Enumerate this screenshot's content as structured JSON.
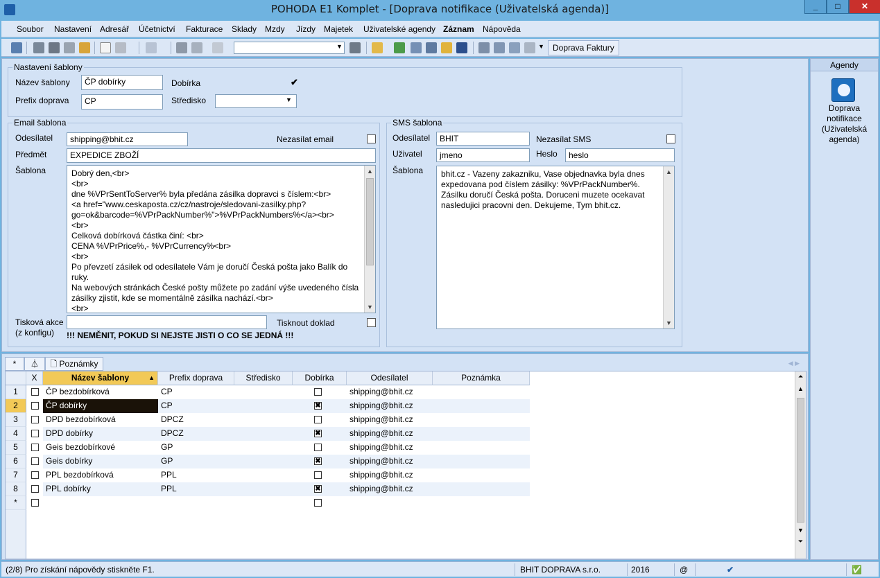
{
  "window": {
    "title": "POHODA E1 Komplet - [Doprava notifikace (Uživatelská agenda)]"
  },
  "menu": [
    "Soubor",
    "Nastavení",
    "Adresář",
    "Účetnictví",
    "Fakturace",
    "Sklady",
    "Mzdy",
    "Jízdy",
    "Majetek",
    "Uživatelské agendy",
    "Záznam",
    "Nápověda"
  ],
  "toolbar": {
    "button_label": "Doprava Faktury",
    "search_value": ""
  },
  "template_settings": {
    "group_label": "Nastavení šablony",
    "name_label": "Název šablony",
    "name_value": "ČP dobírky",
    "cod_label": "Dobírka",
    "cod_checked": "✔",
    "prefix_label": "Prefix doprava",
    "prefix_value": "CP",
    "center_label": "Středisko",
    "center_value": ""
  },
  "email": {
    "group_label": "Email šablona",
    "sender_label": "Odesílatel",
    "sender_value": "shipping@bhit.cz",
    "nosend_label": "Nezasílat email",
    "subject_label": "Předmět",
    "subject_value": "EXPEDICE ZBOŽÍ",
    "template_label": "Šablona",
    "template_lines": [
      "Dobrý den,<br>",
      "<br>",
      "dne %VPrSentToServer% byla předána zásilka dopravci s číslem:<br>",
      "<a href=\"www.ceskaposta.cz/cz/nastroje/sledovani-zasilky.php?",
      "go=ok&barcode=%VPrPackNumber%\">%VPrPackNumbers%</a><br>",
      "<br>",
      "Celková dobírková částka činí: <br>",
      "CENA %VPrPrice%,- %VPrCurrency%<br>",
      "<br>",
      "Po převzetí zásilek od odesílatele Vám je doručí Česká pošta jako Balík do ruky.",
      "Na webových stránkách České pošty můžete po zadání výše uvedeného čísla",
      "zásilky zjistit, kde se momentálně zásilka nachází.<br>",
      "<br>"
    ],
    "print_action_label_1": "Tisková akce",
    "print_action_label_2": "(z konfigu)",
    "print_action_value": "",
    "print_doc_label": "Tisknout doklad",
    "warning": "!!! NEMĚNIT, POKUD SI NEJSTE JISTI O CO SE JEDNÁ !!!"
  },
  "sms": {
    "group_label": "SMS šablona",
    "sender_label": "Odesílatel",
    "sender_value": "BHIT",
    "nosend_label": "Nezasílat SMS",
    "user_label": "Uživatel",
    "user_value": "jmeno",
    "pass_label": "Heslo",
    "pass_value": "heslo",
    "template_label": "Šablona",
    "template_lines": [
      "bhit.cz - Vazeny zakazniku, Vase objednavka byla dnes",
      "expedovana pod číslem zásilky: %VPrPackNumber%.",
      "Zásilku doručí Česká pošta. Doruceni muzete ocekavat",
      "nasledujici pracovni den. Dekujeme, Tym bhit.cz."
    ]
  },
  "agenda": {
    "header": "Agendy",
    "item_lines": [
      "Doprava",
      "notifikace",
      "(Uživatelská",
      "agenda)"
    ]
  },
  "tabs": {
    "notes": "Poznámky"
  },
  "grid": {
    "columns": [
      "X",
      "Název šablony",
      "Prefix doprava",
      "Středisko",
      "Dobírka",
      "Odesílatel",
      "Poznámka"
    ],
    "rows": [
      {
        "n": "1",
        "name": "ČP bezdobírková",
        "prefix": "CP",
        "cod": "",
        "sender": "shipping@bhit.cz"
      },
      {
        "n": "2",
        "name": "ČP dobírky",
        "prefix": "CP",
        "cod": "✖",
        "sender": "shipping@bhit.cz"
      },
      {
        "n": "3",
        "name": "DPD bezdobírková",
        "prefix": "DPCZ",
        "cod": "",
        "sender": "shipping@bhit.cz"
      },
      {
        "n": "4",
        "name": "DPD dobírky",
        "prefix": "DPCZ",
        "cod": "✖",
        "sender": "shipping@bhit.cz"
      },
      {
        "n": "5",
        "name": "Geis bezdobírkové",
        "prefix": "GP",
        "cod": "",
        "sender": "shipping@bhit.cz"
      },
      {
        "n": "6",
        "name": "Geis dobírky",
        "prefix": "GP",
        "cod": "✖",
        "sender": "shipping@bhit.cz"
      },
      {
        "n": "7",
        "name": "PPL bezdobírková",
        "prefix": "PPL",
        "cod": "",
        "sender": "shipping@bhit.cz"
      },
      {
        "n": "8",
        "name": "PPL dobírky",
        "prefix": "PPL",
        "cod": "✖",
        "sender": "shipping@bhit.cz"
      },
      {
        "n": "*",
        "name": "",
        "prefix": "",
        "cod": "",
        "sender": ""
      }
    ]
  },
  "status": {
    "hint": "(2/8) Pro získání nápovědy stiskněte F1.",
    "company": "BHIT DOPRAVA s.r.o.",
    "year": "2016",
    "at": "@"
  }
}
